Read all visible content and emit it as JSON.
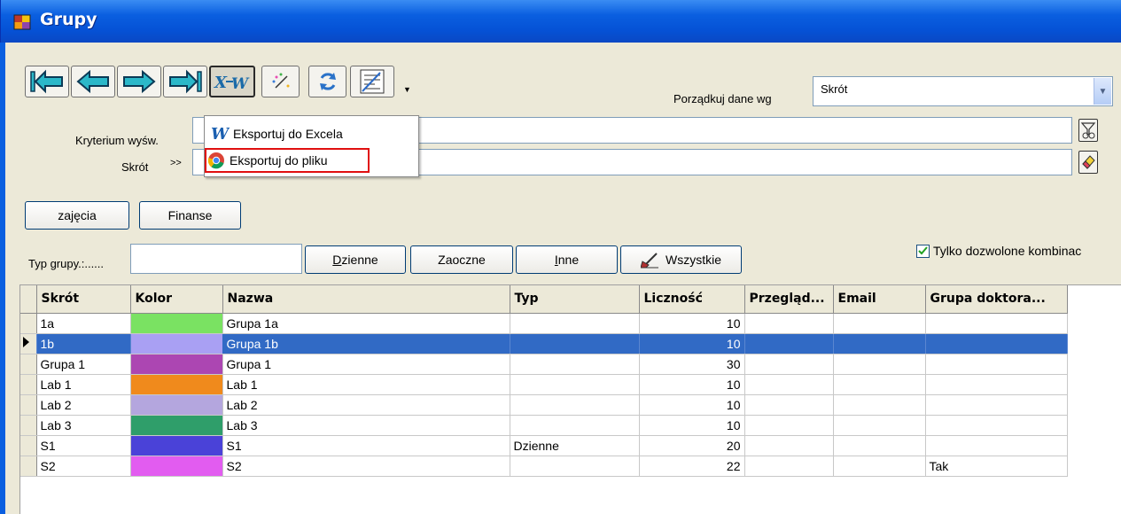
{
  "window": {
    "title": "Grupy"
  },
  "toolbar": {
    "buttons": [
      {
        "icon": "first-record-icon"
      },
      {
        "icon": "previous-record-icon"
      },
      {
        "icon": "next-record-icon"
      },
      {
        "icon": "last-record-icon"
      },
      {
        "icon": "export-excel-icon"
      },
      {
        "icon": "magic-wand-icon"
      },
      {
        "icon": "refresh-icon"
      },
      {
        "icon": "report-icon"
      }
    ]
  },
  "sort": {
    "label": "Porządkuj dane wg",
    "value": "Skrót"
  },
  "filters": {
    "criterion_label": "Kryterium wyśw.",
    "criterion_prefix": "-",
    "skrot_label": "Skrót",
    "skrot_prefix": ">>"
  },
  "export_menu": {
    "items": [
      {
        "label": "Eksportuj do Excela",
        "icon": "excel-w-icon"
      },
      {
        "label": "Eksportuj do pliku",
        "icon": "chrome-icon"
      }
    ]
  },
  "actions": {
    "zajecia": "zajęcia",
    "finanse": "Finanse"
  },
  "group_type": {
    "label": "Typ grupy.:......",
    "value": "",
    "dzienne": "Dzienne",
    "zaoczne": "Zaoczne",
    "inne": "Inne",
    "wszystkie": "Wszystkie"
  },
  "only_allowed": {
    "label": "Tylko dozwolone kombinac",
    "checked": true
  },
  "grid": {
    "columns": [
      "Skrót",
      "Kolor",
      "Nazwa",
      "Typ",
      "Liczność",
      "Przegląd...",
      "Email",
      "Grupa doktora..."
    ],
    "selected_index": 1,
    "rows": [
      {
        "skrot": "1a",
        "kolor": "#7ae262",
        "nazwa": "Grupa 1a",
        "typ": "",
        "licznosc": "10",
        "przeglad": "",
        "email": "",
        "doktorat": ""
      },
      {
        "skrot": "1b",
        "kolor": "#a9a0f3",
        "nazwa": "Grupa 1b",
        "typ": "",
        "licznosc": "10",
        "przeglad": "",
        "email": "",
        "doktorat": ""
      },
      {
        "skrot": "Grupa 1",
        "kolor": "#ac46b2",
        "nazwa": "Grupa 1",
        "typ": "",
        "licznosc": "30",
        "przeglad": "",
        "email": "",
        "doktorat": ""
      },
      {
        "skrot": "Lab 1",
        "kolor": "#f08a1c",
        "nazwa": "Lab 1",
        "typ": "",
        "licznosc": "10",
        "przeglad": "",
        "email": "",
        "doktorat": ""
      },
      {
        "skrot": "Lab 2",
        "kolor": "#b4a6de",
        "nazwa": "Lab 2",
        "typ": "",
        "licznosc": "10",
        "przeglad": "",
        "email": "",
        "doktorat": ""
      },
      {
        "skrot": "Lab 3",
        "kolor": "#2f9e6a",
        "nazwa": "Lab 3",
        "typ": "",
        "licznosc": "10",
        "przeglad": "",
        "email": "",
        "doktorat": ""
      },
      {
        "skrot": "S1",
        "kolor": "#4a42d8",
        "nazwa": "S1",
        "typ": "Dzienne",
        "licznosc": "20",
        "przeglad": "",
        "email": "",
        "doktorat": ""
      },
      {
        "skrot": "S2",
        "kolor": "#e25cf0",
        "nazwa": "S2",
        "typ": "",
        "licznosc": "22",
        "przeglad": "",
        "email": "",
        "doktorat": "Tak"
      }
    ]
  }
}
